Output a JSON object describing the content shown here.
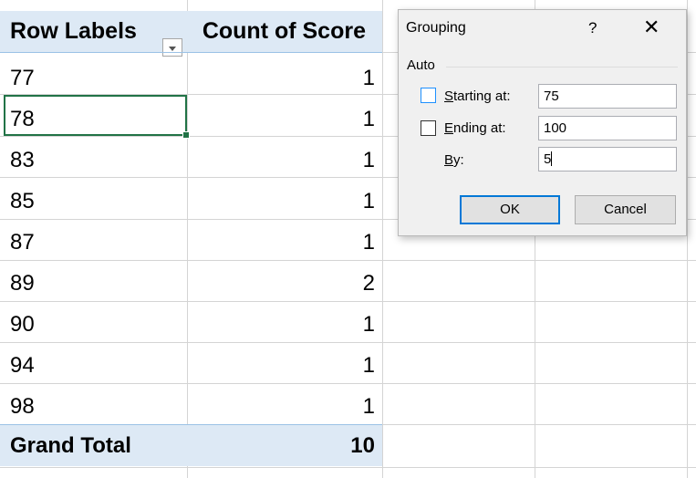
{
  "pivot": {
    "header": {
      "row_labels": "Row Labels",
      "value_header": "Count of Score"
    },
    "rows": [
      {
        "label": "77",
        "value": "1"
      },
      {
        "label": "78",
        "value": "1"
      },
      {
        "label": "83",
        "value": "1"
      },
      {
        "label": "85",
        "value": "1"
      },
      {
        "label": "87",
        "value": "1"
      },
      {
        "label": "89",
        "value": "2"
      },
      {
        "label": "90",
        "value": "1"
      },
      {
        "label": "94",
        "value": "1"
      },
      {
        "label": "98",
        "value": "1"
      }
    ],
    "total": {
      "label": "Grand Total",
      "value": "10"
    }
  },
  "dialog": {
    "title": "Grouping",
    "help": "?",
    "close": "✕",
    "group_label": "Auto",
    "starting_at": {
      "label_prefix": "",
      "label_accel": "S",
      "label_rest": "tarting at:",
      "value": "75",
      "checked": false
    },
    "ending_at": {
      "label_accel": "E",
      "label_rest": "nding at:",
      "value": "100",
      "checked": false
    },
    "by": {
      "label_accel": "B",
      "label_rest": "y:",
      "value": "5"
    },
    "ok_label": "OK",
    "cancel_label": "Cancel"
  }
}
